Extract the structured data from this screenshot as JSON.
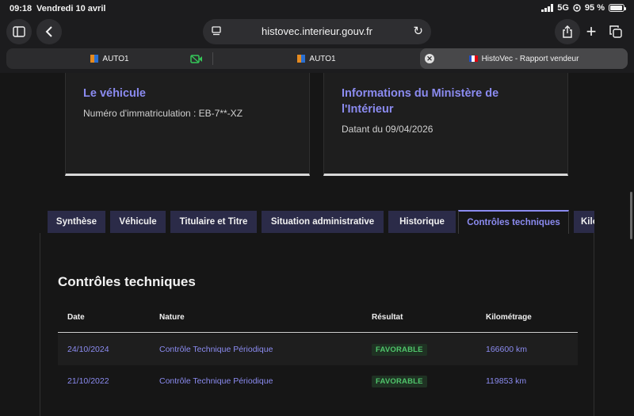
{
  "status": {
    "time": "09:18",
    "date": "Vendredi 10 avril",
    "network": "5G",
    "battery": "95 %"
  },
  "browser": {
    "url": "histovec.interieur.gouv.fr",
    "tabs": [
      {
        "label": "AUTO1"
      },
      {
        "label": "AUTO1"
      },
      {
        "label": "HistoVec - Rapport vendeur"
      }
    ]
  },
  "cards": {
    "vehicle": {
      "title": "Le véhicule",
      "text": "Numéro d'immatriculation : EB-7**-XZ"
    },
    "ministry": {
      "title_line1": "Informations du Ministère de",
      "title_line2": "l'Intérieur",
      "text": "Datant du 09/04/2026"
    }
  },
  "page_tabs": [
    {
      "label": "Synthèse"
    },
    {
      "label": "Véhicule"
    },
    {
      "label": "Titulaire et Titre"
    },
    {
      "label": "Situation administrative"
    },
    {
      "label": "Historique"
    },
    {
      "label": "Contrôles techniques"
    },
    {
      "label": "Kilo"
    }
  ],
  "panel": {
    "title": "Contrôles techniques",
    "headers": {
      "date": "Date",
      "nature": "Nature",
      "result": "Résultat",
      "mileage": "Kilométrage"
    },
    "rows": [
      {
        "date": "24/10/2024",
        "nature": "Contrôle Technique Périodique",
        "result": "FAVORABLE",
        "mileage": "166600 km"
      },
      {
        "date": "21/10/2022",
        "nature": "Contrôle Technique Périodique",
        "result": "FAVORABLE",
        "mileage": "119853 km"
      }
    ]
  },
  "colors": {
    "accent": "#8b8bf0",
    "tab_bg": "#2b2b48",
    "success": "#4fc46a"
  }
}
